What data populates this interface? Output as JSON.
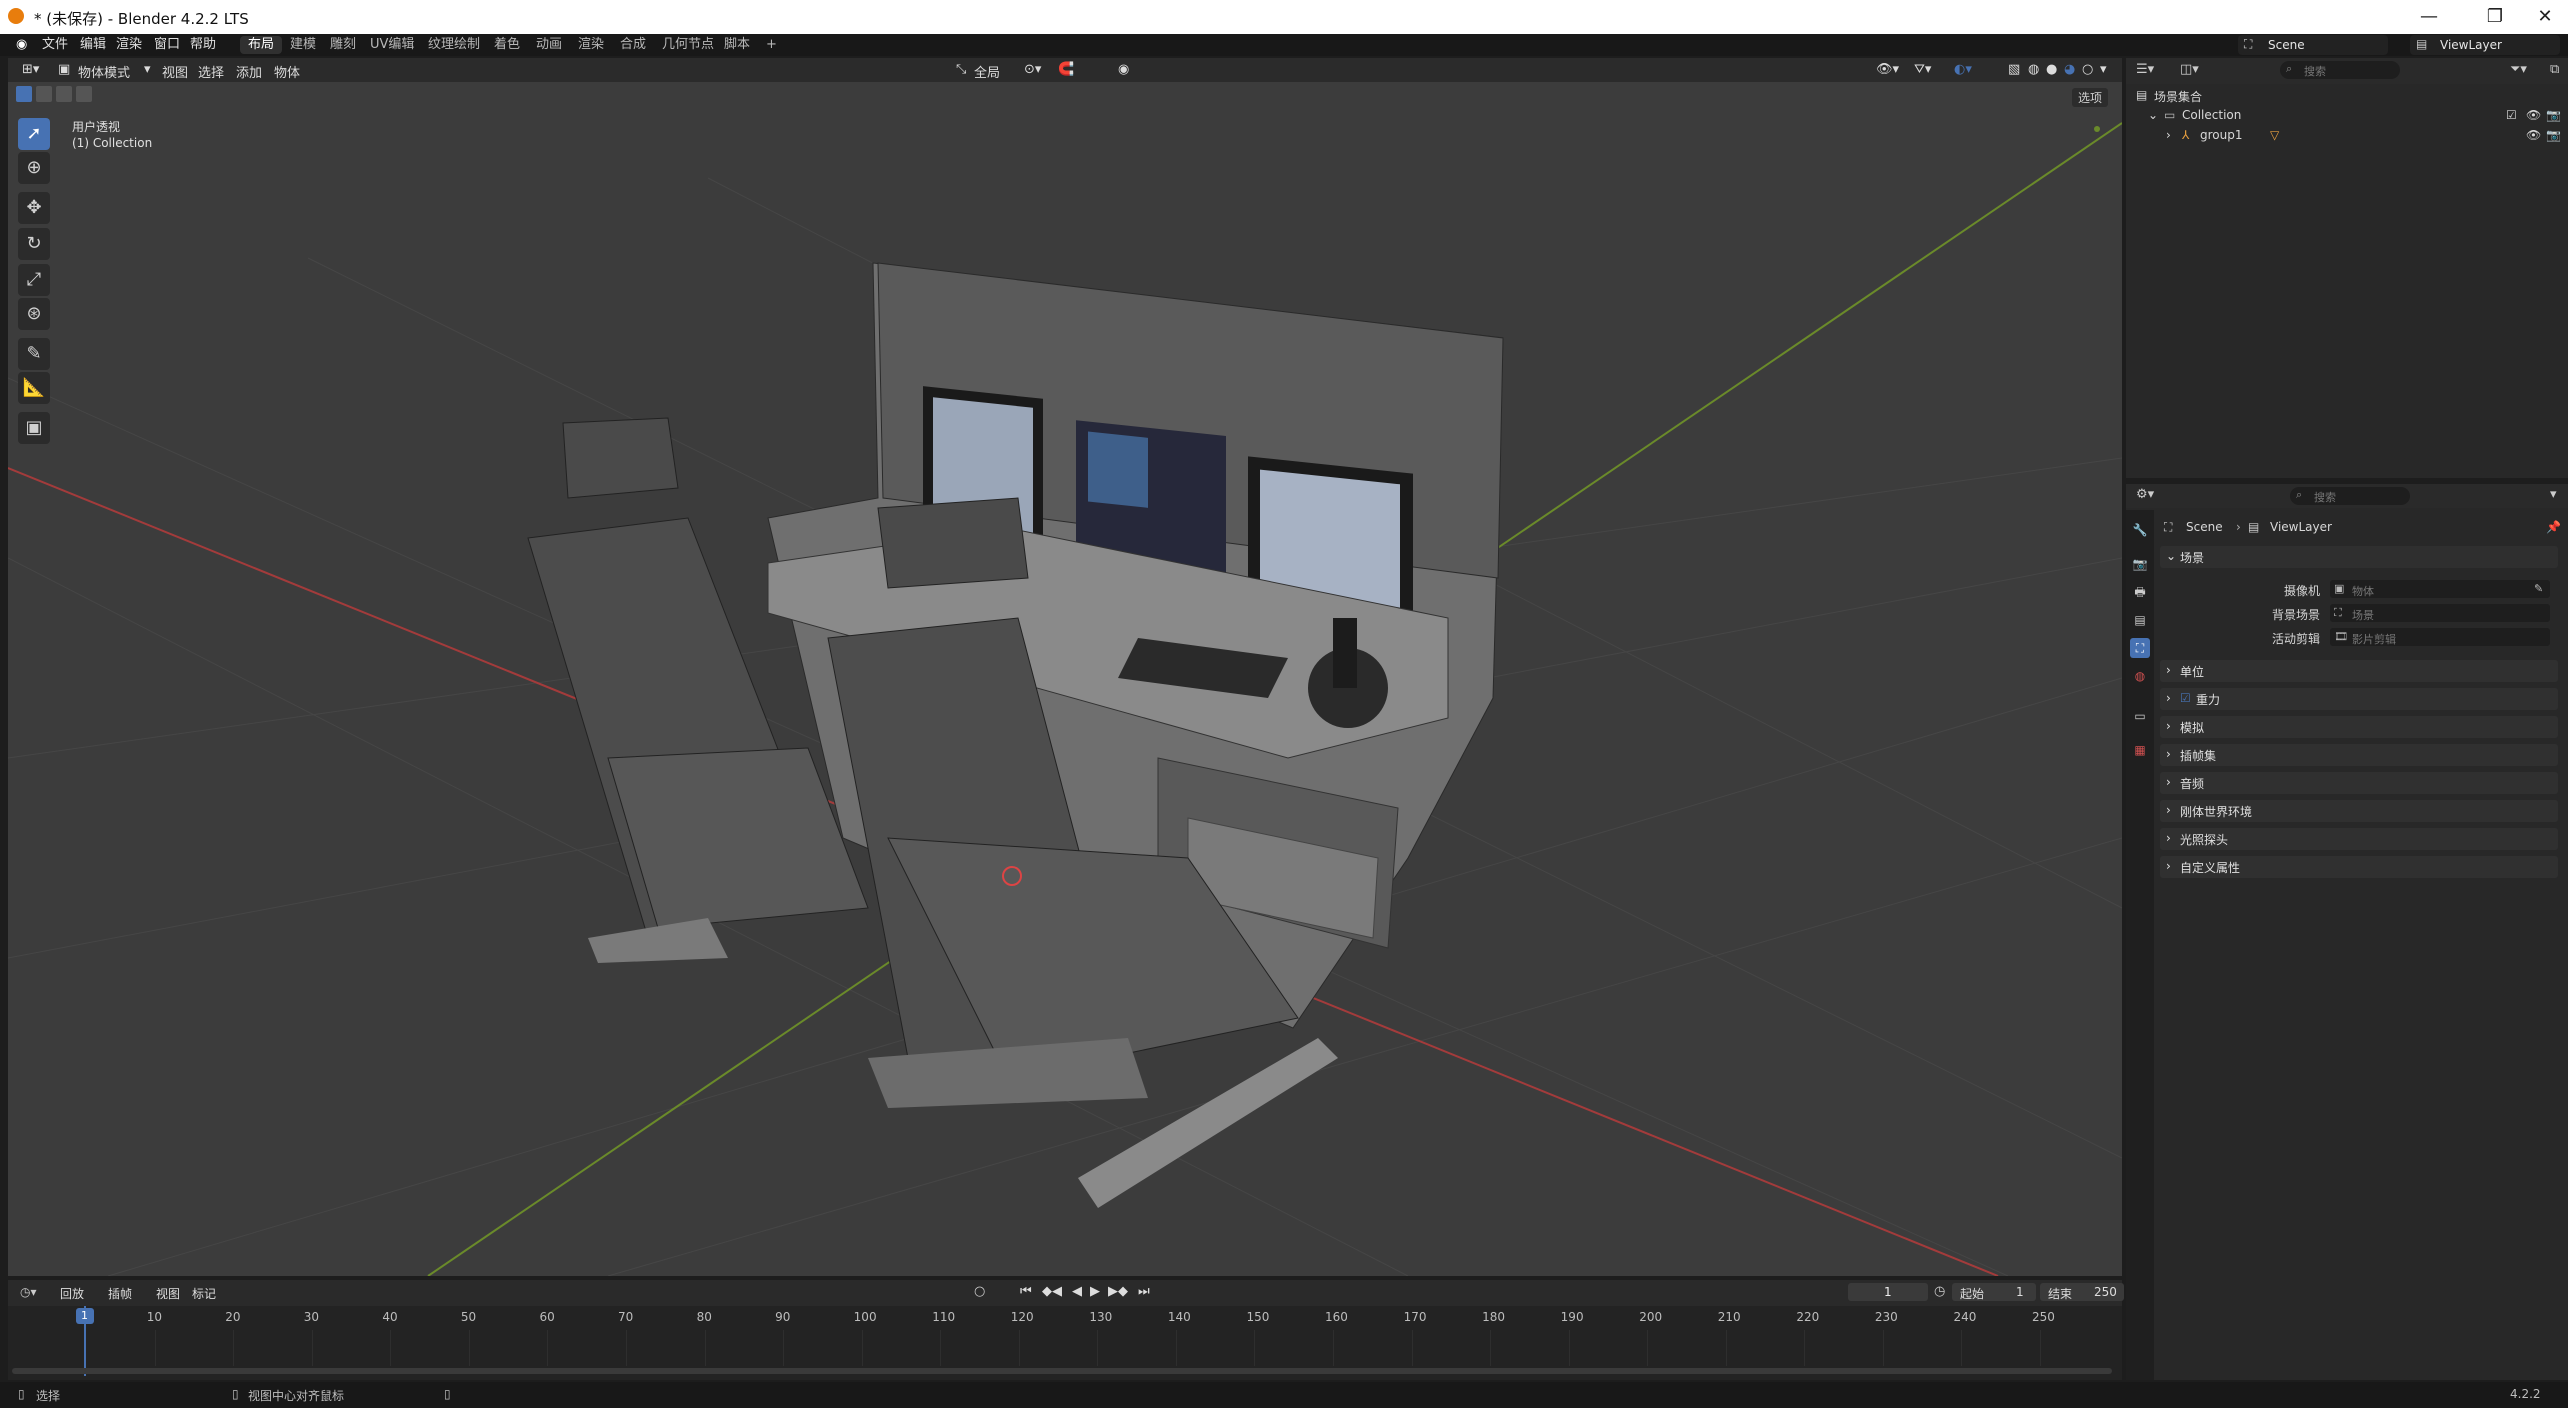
{
  "window": {
    "title": "* (未保存) - Blender 4.2.2 LTS",
    "minimize": "—",
    "maximize": "❐",
    "close": "✕"
  },
  "menu": {
    "items": [
      "文件",
      "编辑",
      "渲染",
      "窗口",
      "帮助"
    ]
  },
  "workspaces": {
    "tabs": [
      "布局",
      "建模",
      "雕刻",
      "UV编辑",
      "纹理绘制",
      "着色",
      "动画",
      "渲染",
      "合成",
      "几何节点",
      "脚本"
    ],
    "add": "+"
  },
  "viewport": {
    "mode": "物体模式",
    "menus": [
      "视图",
      "选择",
      "添加",
      "物体"
    ],
    "transform_orientation": "全局",
    "options_label": "选项",
    "view_name": "用户透视",
    "collection_label": "(1) Collection"
  },
  "scene_selector": {
    "value": "Scene"
  },
  "viewlayer_selector": {
    "value": "ViewLayer"
  },
  "outliner": {
    "search_placeholder": "搜索",
    "root": "场景集合",
    "collection": "Collection",
    "object": "group1"
  },
  "properties": {
    "search_placeholder": "搜索",
    "breadcrumb_scene": "Scene",
    "breadcrumb_layer": "ViewLayer",
    "section_scene": "场景",
    "camera_label": "摄像机",
    "camera_placeholder": "物体",
    "bg_scene_label": "背景场景",
    "bg_scene_placeholder": "场景",
    "active_clip_label": "活动剪辑",
    "active_clip_placeholder": "影片剪辑",
    "sections": [
      "单位",
      "重力",
      "模拟",
      "插帧集",
      "音频",
      "刚体世界环境",
      "光照探头",
      "自定义属性"
    ]
  },
  "timeline": {
    "menus": [
      "回放",
      "插帧",
      "视图",
      "标记"
    ],
    "current_frame": "1",
    "start_label": "起始",
    "start_value": "1",
    "end_label": "结束",
    "end_value": "250",
    "ticks": [
      "1",
      "10",
      "20",
      "30",
      "40",
      "50",
      "60",
      "70",
      "80",
      "90",
      "100",
      "110",
      "120",
      "130",
      "140",
      "150",
      "160",
      "170",
      "180",
      "190",
      "200",
      "210",
      "220",
      "230",
      "240",
      "250"
    ]
  },
  "status": {
    "select": "选择",
    "center_view": "视图中心对齐鼠标",
    "version": "4.2.2"
  },
  "colors": {
    "accent": "#4772b3",
    "x_axis": "#a33b3b",
    "y_axis": "#6a8a2a",
    "viewport_bg": "#3c3c3c"
  }
}
